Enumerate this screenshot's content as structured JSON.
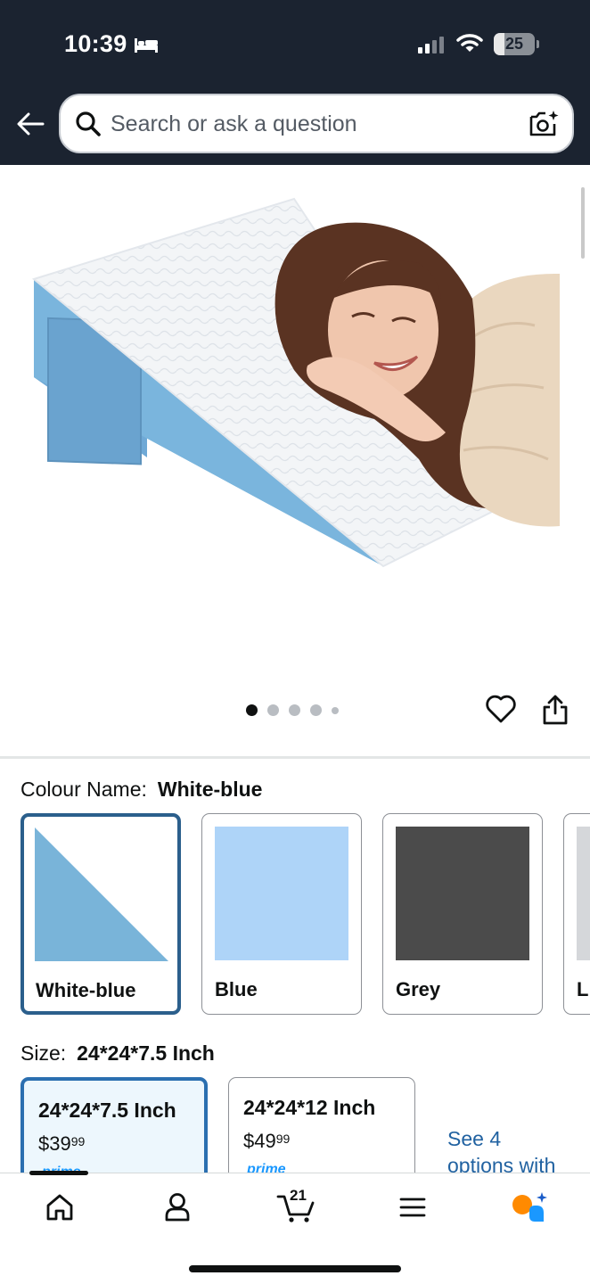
{
  "status_bar": {
    "time": "10:39",
    "battery": "25",
    "battery_fraction": 0.25
  },
  "search": {
    "placeholder": "Search or ask a question"
  },
  "gallery": {
    "image_count": 5,
    "active_index": 0
  },
  "colour": {
    "label": "Colour Name:",
    "selected": "White-blue",
    "options": [
      {
        "name": "White-blue",
        "selected": true
      },
      {
        "name": "Blue",
        "selected": false
      },
      {
        "name": "Grey",
        "selected": false
      },
      {
        "name": "L",
        "selected": false
      }
    ]
  },
  "size": {
    "label": "Size:",
    "selected": "24*24*7.5 Inch",
    "options": [
      {
        "name": "24*24*7.5 Inch",
        "price_whole": "$39",
        "price_fraction": "99",
        "badge": "prime",
        "selected": true
      },
      {
        "name": "24*24*12 Inch",
        "price_whole": "$49",
        "price_fraction": "99",
        "badge": "prime",
        "selected": false
      }
    ],
    "see_more_line1": "See 4",
    "see_more_line2": "options with"
  },
  "bottom_nav": {
    "cart_count": "21",
    "items": [
      "home-icon",
      "account-icon",
      "cart-icon",
      "menu-icon",
      "rufus-icon"
    ]
  },
  "colors": {
    "header_bg": "#1b2330",
    "selected_border": "#2b5f8c",
    "link": "#2162a1",
    "prime": "#1a98ff",
    "swatch_blue": "#aed4f8",
    "swatch_grey": "#4b4b4b",
    "wedge_blue": "#79b4d9"
  }
}
